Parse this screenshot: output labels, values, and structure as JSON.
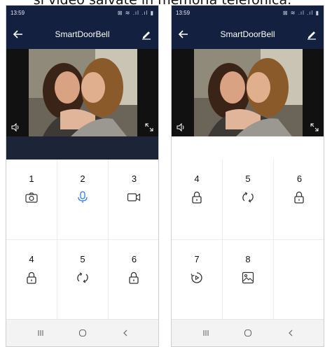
{
  "caption": "si video salvate in memoria telefonica.",
  "screens": [
    {
      "status_time": "13:59",
      "status_right": "⊠ ≋ .ıl .ıl ▮",
      "app_title": "SmartDoorBell",
      "cells": [
        {
          "label": "1",
          "icon": "camera-icon",
          "color": "#333"
        },
        {
          "label": "2",
          "icon": "microphone-icon",
          "color": "#2f7de1"
        },
        {
          "label": "3",
          "icon": "video-icon",
          "color": "#333"
        },
        {
          "label": "4",
          "icon": "lock-icon",
          "color": "#333"
        },
        {
          "label": "5",
          "icon": "rotate-icon",
          "color": "#333"
        },
        {
          "label": "6",
          "icon": "lock-icon",
          "color": "#333"
        }
      ]
    },
    {
      "status_time": "13:59",
      "status_right": "⊠ ≋ .ıl .ıl ▮",
      "app_title": "SmartDoorBell",
      "cells": [
        {
          "label": "4",
          "icon": "lock-icon",
          "color": "#333"
        },
        {
          "label": "5",
          "icon": "rotate-icon",
          "color": "#333"
        },
        {
          "label": "6",
          "icon": "lock-icon",
          "color": "#333"
        },
        {
          "label": "7",
          "icon": "playback-icon",
          "color": "#333"
        },
        {
          "label": "8",
          "icon": "gallery-icon",
          "color": "#333"
        },
        {
          "label": "",
          "icon": "",
          "color": "#333"
        }
      ]
    }
  ]
}
